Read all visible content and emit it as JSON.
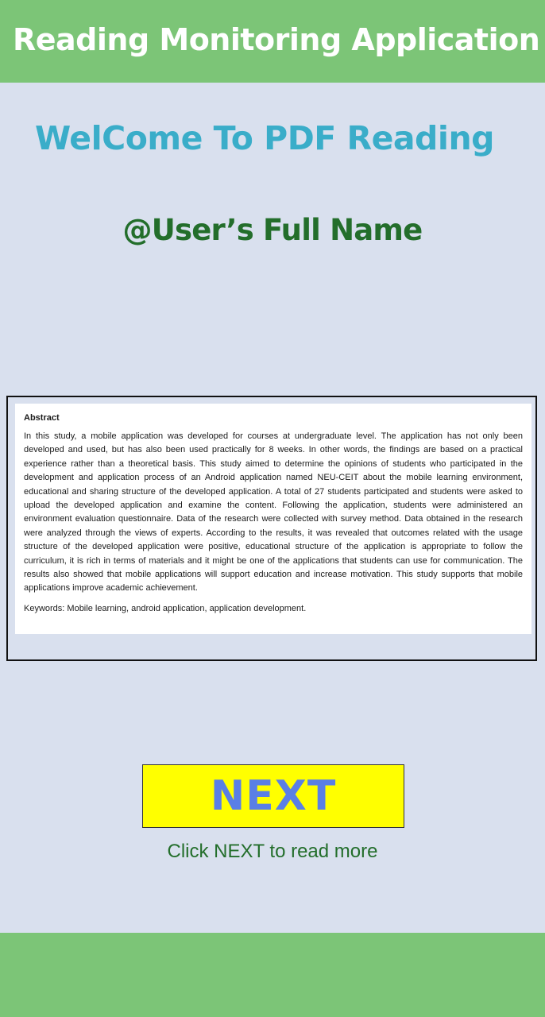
{
  "app_bar": {
    "title": "Reading Monitoring Application"
  },
  "welcome": {
    "text": "WelCome To PDF Reading"
  },
  "user": {
    "name": "@User’s Full Name"
  },
  "document": {
    "heading": "Abstract",
    "body": "In this study, a mobile application was developed for courses at undergraduate level. The application has not only been developed and used, but has also been used practically for 8 weeks. In other words, the findings are based on a practical experience rather than a theoretical basis. This study aimed to determine the opinions of students who participated in the development and application process of an Android application named NEU-CEIT about the mobile learning environment, educational and sharing structure of the developed application. A total of 27 students participated and students were asked to upload the developed application and examine the content. Following the application, students were administered an environment evaluation questionnaire. Data of the research were collected with survey method. Data obtained in the research were analyzed through the views of experts. According to the results, it was revealed that outcomes related with the usage structure of the developed application were positive, educational structure of the application is appropriate to follow the curriculum, it is rich in terms of materials and it might be one of the applications that students can use for communication. The results also showed that mobile applications will support education and increase motivation. This study supports that mobile applications improve academic achievement.",
    "keywords": "Keywords: Mobile learning, android application, application development."
  },
  "next_button": {
    "label": "NEXT"
  },
  "hint": {
    "text": "Click NEXT to read more"
  },
  "colors": {
    "app_bar": "#7cc577",
    "background": "#d9e0ee",
    "welcome_text": "#3aadc9",
    "username_text": "#236e2b",
    "next_button_bg": "#ffff00",
    "next_button_text": "#5a7fe6"
  }
}
